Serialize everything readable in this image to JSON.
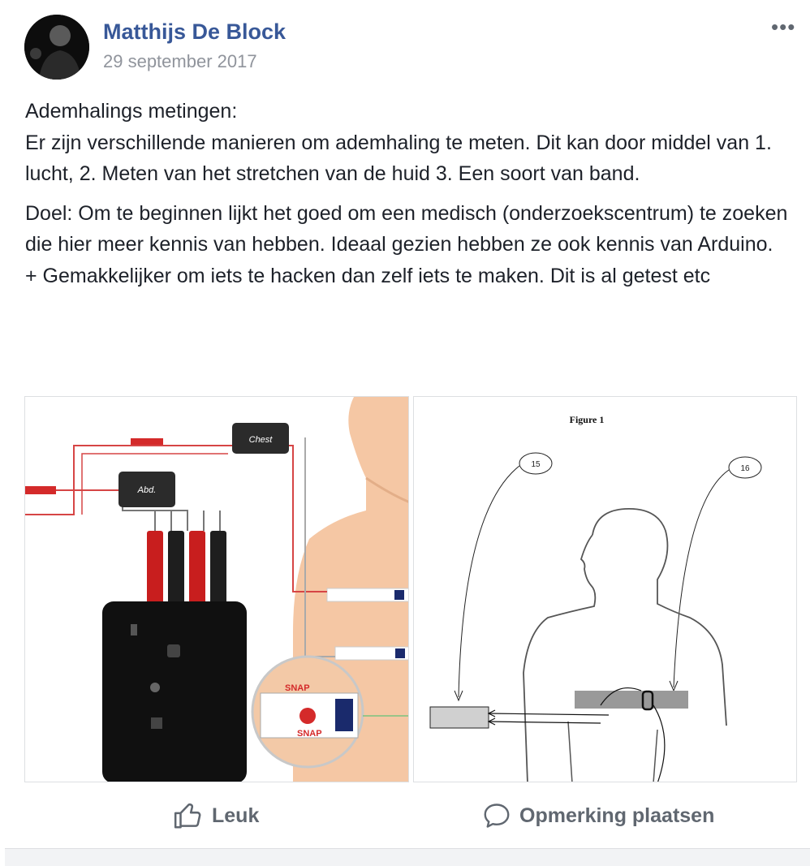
{
  "post": {
    "author": "Matthijs De Block",
    "date": "29 september 2017",
    "more_label": "•••",
    "paragraphs": [
      "Ademhalings metingen:\nEr zijn verschillende manieren om ademhaling te meten. Dit kan door middel van 1. lucht, 2. Meten van het stretchen van de huid 3. Een soort van band.",
      "Doel: Om te beginnen lijkt het goed om een medisch (onderzoekscentrum) te zoeken die hier meer kennis van hebben. Ideaal gezien hebben ze ook kennis van Arduino.\n+ Gemakkelijker om iets te hacken dan zelf iets te maken. Dit is al getest etc"
    ]
  },
  "photo1": {
    "chest_label": "Chest",
    "abd_label": "Abd.",
    "snap_label": "SNAP"
  },
  "photo2": {
    "figure_title": "Figure 1",
    "callout_15": "15",
    "callout_16": "16"
  },
  "actions": {
    "like_label": "Leuk",
    "comment_label": "Opmerking plaatsen"
  },
  "colors": {
    "link": "#385898",
    "muted": "#90949c",
    "action": "#606770"
  }
}
